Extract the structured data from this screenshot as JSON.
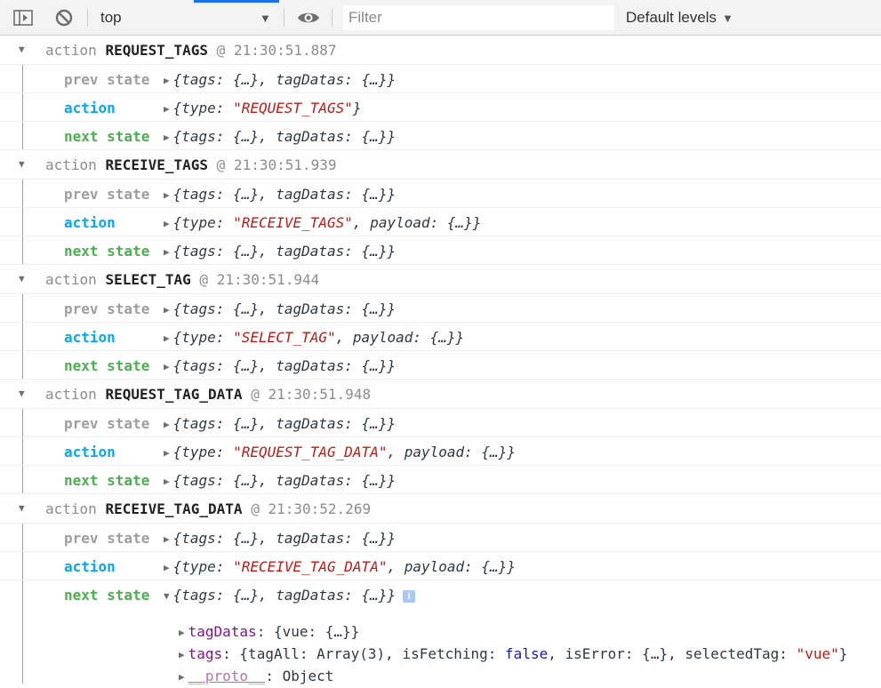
{
  "toolbar": {
    "context_label": "top",
    "filter_placeholder": "Filter",
    "levels_label": "Default levels"
  },
  "icons": {
    "sidebar": "sidebar-toggle-icon",
    "clear": "clear-console-icon",
    "context_dropdown": "chevron-down-icon",
    "eye": "eye-icon",
    "levels_dropdown": "chevron-down-icon",
    "info": "info-icon"
  },
  "colors": {
    "prev_state": "#9e9e9e",
    "action": "#03a9f4",
    "next_state": "#4caf50",
    "string": "#c41a16",
    "property_key": "#881391",
    "boolean": "#1a1aa6"
  },
  "labels": {
    "action_word": "action",
    "at": "@",
    "prev": "prev state",
    "action": "action",
    "next": "next state"
  },
  "state_summary": "{tags: {…}, tagDatas: {…}}",
  "groups": [
    {
      "name": "REQUEST_TAGS",
      "time": "21:30:51.887",
      "action_obj": "{type: \"REQUEST_TAGS\"}"
    },
    {
      "name": "RECEIVE_TAGS",
      "time": "21:30:51.939",
      "action_obj": "{type: \"RECEIVE_TAGS\", payload: {…}}"
    },
    {
      "name": "SELECT_TAG",
      "time": "21:30:51.944",
      "action_obj": "{type: \"SELECT_TAG\", payload: {…}}"
    },
    {
      "name": "REQUEST_TAG_DATA",
      "time": "21:30:51.948",
      "action_obj": "{type: \"REQUEST_TAG_DATA\", payload: {…}}"
    },
    {
      "name": "RECEIVE_TAG_DATA",
      "time": "21:30:52.269",
      "action_obj": "{type: \"RECEIVE_TAG_DATA\", payload: {…}}"
    }
  ],
  "expanded": {
    "info": "i",
    "tagDatas_key": "tagDatas",
    "tagDatas_value": "{vue: {…}}",
    "tags_key": "tags",
    "tags_value_prefix": "{tagAll: Array(3), isFetching: ",
    "tags_value_bool": "false",
    "tags_value_mid": ", isError: {…}, selectedTag: ",
    "tags_value_str": "\"vue\"",
    "tags_value_suffix": "}",
    "proto_key": "__proto__",
    "proto_value": "Object"
  }
}
